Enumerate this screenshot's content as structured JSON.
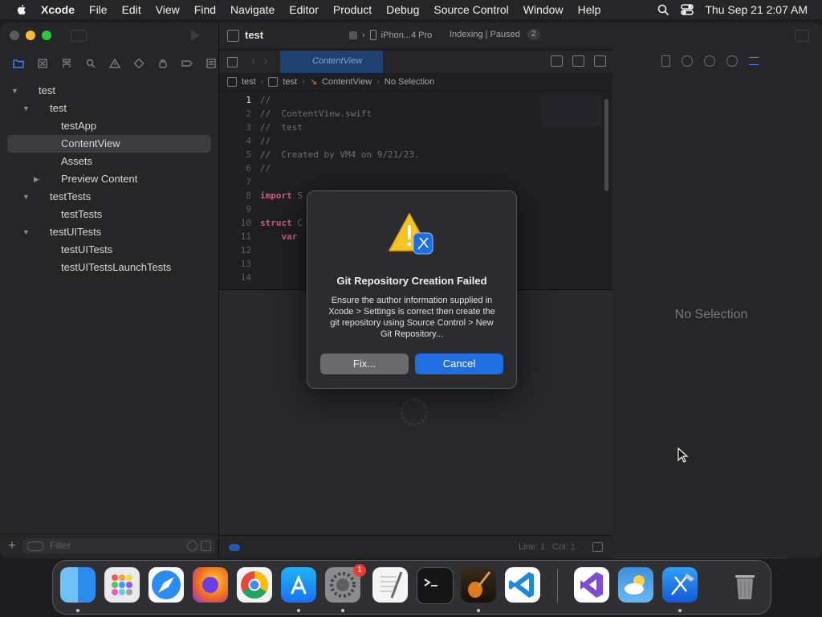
{
  "menubar": {
    "items": [
      "Xcode",
      "File",
      "Edit",
      "View",
      "Find",
      "Navigate",
      "Editor",
      "Product",
      "Debug",
      "Source Control",
      "Window",
      "Help"
    ],
    "clock": "Thu Sep 21  2:07 AM"
  },
  "toolbar": {
    "project": "test",
    "destination": "iPhon...4 Pro",
    "status": "Indexing | Paused",
    "badge": "2"
  },
  "navigator": {
    "tree": [
      {
        "label": "test",
        "level": 0,
        "disclosure": "open"
      },
      {
        "label": "test",
        "level": 1,
        "disclosure": "open"
      },
      {
        "label": "testApp",
        "level": 2,
        "disclosure": "none"
      },
      {
        "label": "ContentView",
        "level": 2,
        "disclosure": "none",
        "selected": true
      },
      {
        "label": "Assets",
        "level": 2,
        "disclosure": "none"
      },
      {
        "label": "Preview Content",
        "level": 2,
        "disclosure": "closed"
      },
      {
        "label": "testTests",
        "level": 1,
        "disclosure": "open"
      },
      {
        "label": "testTests",
        "level": 2,
        "disclosure": "none"
      },
      {
        "label": "testUITests",
        "level": 1,
        "disclosure": "open"
      },
      {
        "label": "testUITests",
        "level": 2,
        "disclosure": "none"
      },
      {
        "label": "testUITestsLaunchTests",
        "level": 2,
        "disclosure": "none"
      }
    ],
    "filter_placeholder": "Filter"
  },
  "editor": {
    "active_tab": "ContentView",
    "breadcrumb": [
      "test",
      "test",
      "ContentView",
      "No Selection"
    ],
    "code_lines": [
      {
        "n": "1",
        "text": "//"
      },
      {
        "n": "2",
        "text": "//  ContentView.swift"
      },
      {
        "n": "3",
        "text": "//  test"
      },
      {
        "n": "4",
        "text": "//"
      },
      {
        "n": "5",
        "text": "//  Created by VM4 on 9/21/23."
      },
      {
        "n": "6",
        "text": "//"
      },
      {
        "n": "7",
        "text": ""
      },
      {
        "n": "8",
        "kw": "import",
        "text": " S"
      },
      {
        "n": "9",
        "text": ""
      },
      {
        "n": "10",
        "kw": "struct",
        "text": " C"
      },
      {
        "n": "11",
        "kw": "    var",
        "text": ""
      },
      {
        "n": "12",
        "text": ""
      },
      {
        "n": "13",
        "text": ""
      },
      {
        "n": "14",
        "text": ""
      }
    ],
    "status_line": "Line: 1",
    "status_col": "Col: 1"
  },
  "inspector": {
    "empty_text": "No Selection"
  },
  "dialog": {
    "title": "Git Repository Creation Failed",
    "message": "Ensure the author information supplied in Xcode > Settings is correct then create the git repository using Source Control > New Git Repository...",
    "fix_label": "Fix...",
    "cancel_label": "Cancel"
  },
  "dock": {
    "apps": [
      {
        "name": "finder-icon",
        "color": "#2b8df0",
        "running": true
      },
      {
        "name": "launchpad-icon",
        "color": "#e9e9ee",
        "running": false
      },
      {
        "name": "safari-icon",
        "color": "#2a8cf5",
        "running": false
      },
      {
        "name": "firefox-icon",
        "color": "#f26b1d",
        "running": false
      },
      {
        "name": "chrome-icon",
        "color": "#f3f3f3",
        "running": false
      },
      {
        "name": "app-store-icon",
        "color": "#1b8ff5",
        "running": true
      },
      {
        "name": "system-settings-icon",
        "color": "#8a8a8f",
        "running": true
      },
      {
        "name": "textedit-icon",
        "color": "#f4f4f4",
        "running": false
      },
      {
        "name": "terminal-icon",
        "color": "#151515",
        "running": false
      },
      {
        "name": "garageband-icon",
        "color": "#e07a1f",
        "running": true
      },
      {
        "name": "vscode-icon",
        "color": "#1f8ad6",
        "running": false
      },
      {
        "name": "visual-studio-icon",
        "color": "#ffffff",
        "running": false
      },
      {
        "name": "weather-icon",
        "color": "#3c8fe0",
        "running": false
      },
      {
        "name": "xcode-icon",
        "color": "#1e7ee8",
        "running": true
      },
      {
        "name": "trash-icon",
        "color": "#9a9a9e",
        "running": false
      }
    ],
    "settings_badge": "1"
  }
}
